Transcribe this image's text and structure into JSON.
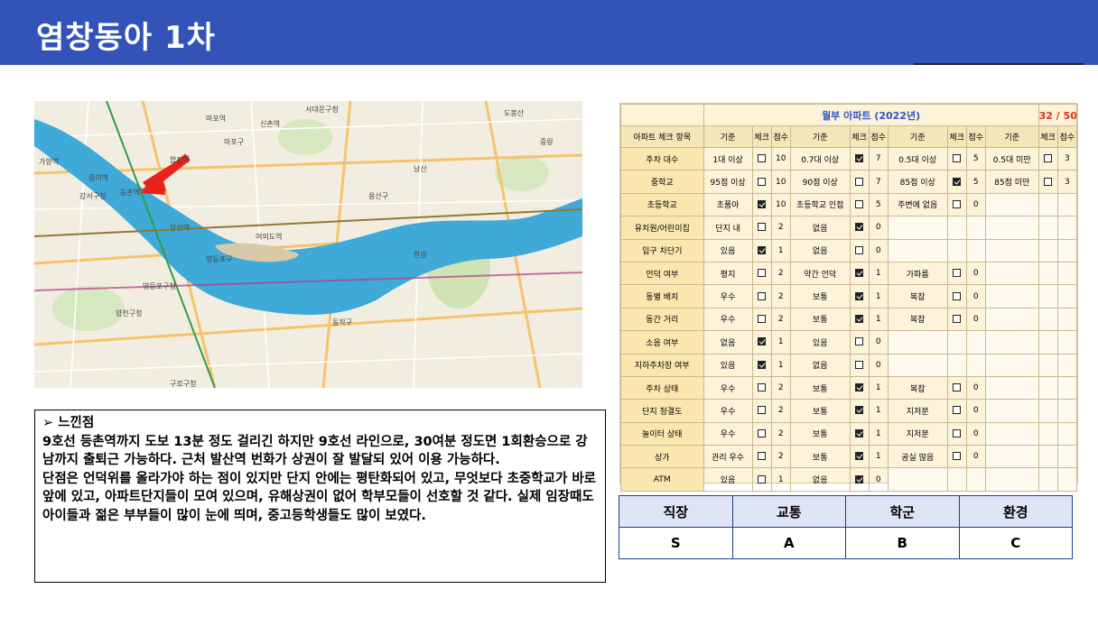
{
  "title": "염창동아 1차",
  "map": {
    "labels": [
      "서대문구청",
      "마포구",
      "마포역",
      "영등포구",
      "강서구청",
      "양천구청",
      "구로구청",
      "용산구",
      "동작구",
      "여의도역",
      "당산역",
      "한강",
      "도봉산",
      "가양역",
      "증미역",
      "등촌역",
      "신촌역",
      "합정역",
      "영등포구청",
      "중랑",
      "남산"
    ]
  },
  "notes": {
    "heading": "➢ 느낀점",
    "paragraph1": "9호선 등촌역까지 도보 13분 정도 걸리긴 하지만 9호선 라인으로, 30여분 정도면 1회환승으로 강남까지 출퇴근 가능하다. 근처 발산역 번화가 상권이 잘 발달되 있어 이용 가능하다.",
    "paragraph2": "단점은 언덕위를 올라가야 하는 점이 있지만 단지 안에는 평탄화되어 있고, 무엇보다 초중학교가 바로 앞에 있고, 아파트단지들이 모여 있으며, 유해상권이 없어 학부모들이 선호할 것 같다. 실제 임장때도 아이들과 젊은 부부들이 많이 눈에 띄며, 중고등학생들도 많이 보였다."
  },
  "checklist": {
    "title": "월부 아파트 (2022년)",
    "score": "32 / 50 점",
    "col_item": "아파트 체크 항목",
    "col_criteria": "기준",
    "col_check": "체크",
    "col_points": "점수",
    "rows": [
      {
        "item": "주차 대수",
        "c": [
          [
            "1대 이상",
            false,
            "10"
          ],
          [
            "0.7대 이상",
            true,
            "7"
          ],
          [
            "0.5대 이상",
            false,
            "5"
          ],
          [
            "0.5대 미만",
            false,
            "3"
          ]
        ]
      },
      {
        "item": "중학교",
        "c": [
          [
            "95점 이상",
            false,
            "10"
          ],
          [
            "90점 이상",
            false,
            "7"
          ],
          [
            "85점 이상",
            true,
            "5"
          ],
          [
            "85점 미만",
            false,
            "3"
          ]
        ]
      },
      {
        "item": "초등학교",
        "c": [
          [
            "초품아",
            true,
            "10"
          ],
          [
            "초등학교 인접",
            false,
            "5"
          ],
          [
            "주변에 없음",
            false,
            "0"
          ]
        ]
      },
      {
        "item": "유치원/어린이집",
        "c": [
          [
            "단지 내",
            false,
            "2"
          ],
          [
            "없음",
            true,
            "0"
          ]
        ]
      },
      {
        "item": "입구 차단기",
        "c": [
          [
            "있음",
            true,
            "1"
          ],
          [
            "없음",
            false,
            "0"
          ]
        ]
      },
      {
        "item": "언덕 여부",
        "c": [
          [
            "평지",
            false,
            "2"
          ],
          [
            "약간 언덕",
            true,
            "1"
          ],
          [
            "가파름",
            false,
            "0"
          ]
        ]
      },
      {
        "item": "동별 배치",
        "c": [
          [
            "우수",
            false,
            "2"
          ],
          [
            "보통",
            true,
            "1"
          ],
          [
            "복잡",
            false,
            "0"
          ]
        ]
      },
      {
        "item": "동간 거리",
        "c": [
          [
            "우수",
            false,
            "2"
          ],
          [
            "보통",
            true,
            "1"
          ],
          [
            "복잡",
            false,
            "0"
          ]
        ]
      },
      {
        "item": "소음 여부",
        "c": [
          [
            "없음",
            true,
            "1"
          ],
          [
            "있음",
            false,
            "0"
          ]
        ]
      },
      {
        "item": "지하주차장 여부",
        "c": [
          [
            "있음",
            true,
            "1"
          ],
          [
            "없음",
            false,
            "0"
          ]
        ]
      },
      {
        "item": "주차 상태",
        "c": [
          [
            "우수",
            false,
            "2"
          ],
          [
            "보통",
            true,
            "1"
          ],
          [
            "복잡",
            false,
            "0"
          ]
        ]
      },
      {
        "item": "단지 청결도",
        "c": [
          [
            "우수",
            false,
            "2"
          ],
          [
            "보통",
            true,
            "1"
          ],
          [
            "지저분",
            false,
            "0"
          ]
        ]
      },
      {
        "item": "놀이터 상태",
        "c": [
          [
            "우수",
            false,
            "2"
          ],
          [
            "보통",
            true,
            "1"
          ],
          [
            "지저분",
            false,
            "0"
          ]
        ]
      },
      {
        "item": "상가",
        "c": [
          [
            "관리 우수",
            false,
            "2"
          ],
          [
            "보통",
            true,
            "1"
          ],
          [
            "공실 많음",
            false,
            "0"
          ]
        ]
      },
      {
        "item": "ATM",
        "c": [
          [
            "있음",
            false,
            "1"
          ],
          [
            "없음",
            true,
            "0"
          ]
        ]
      }
    ]
  },
  "rating": {
    "headers": [
      "직장",
      "교통",
      "학군",
      "환경"
    ],
    "values": [
      "S",
      "A",
      "B",
      "C"
    ]
  },
  "colors": {
    "title_bar": "#3353b8",
    "river": "#3fa9d8",
    "arrow": "#e8231b",
    "table_bg": "#fdf3d9"
  }
}
